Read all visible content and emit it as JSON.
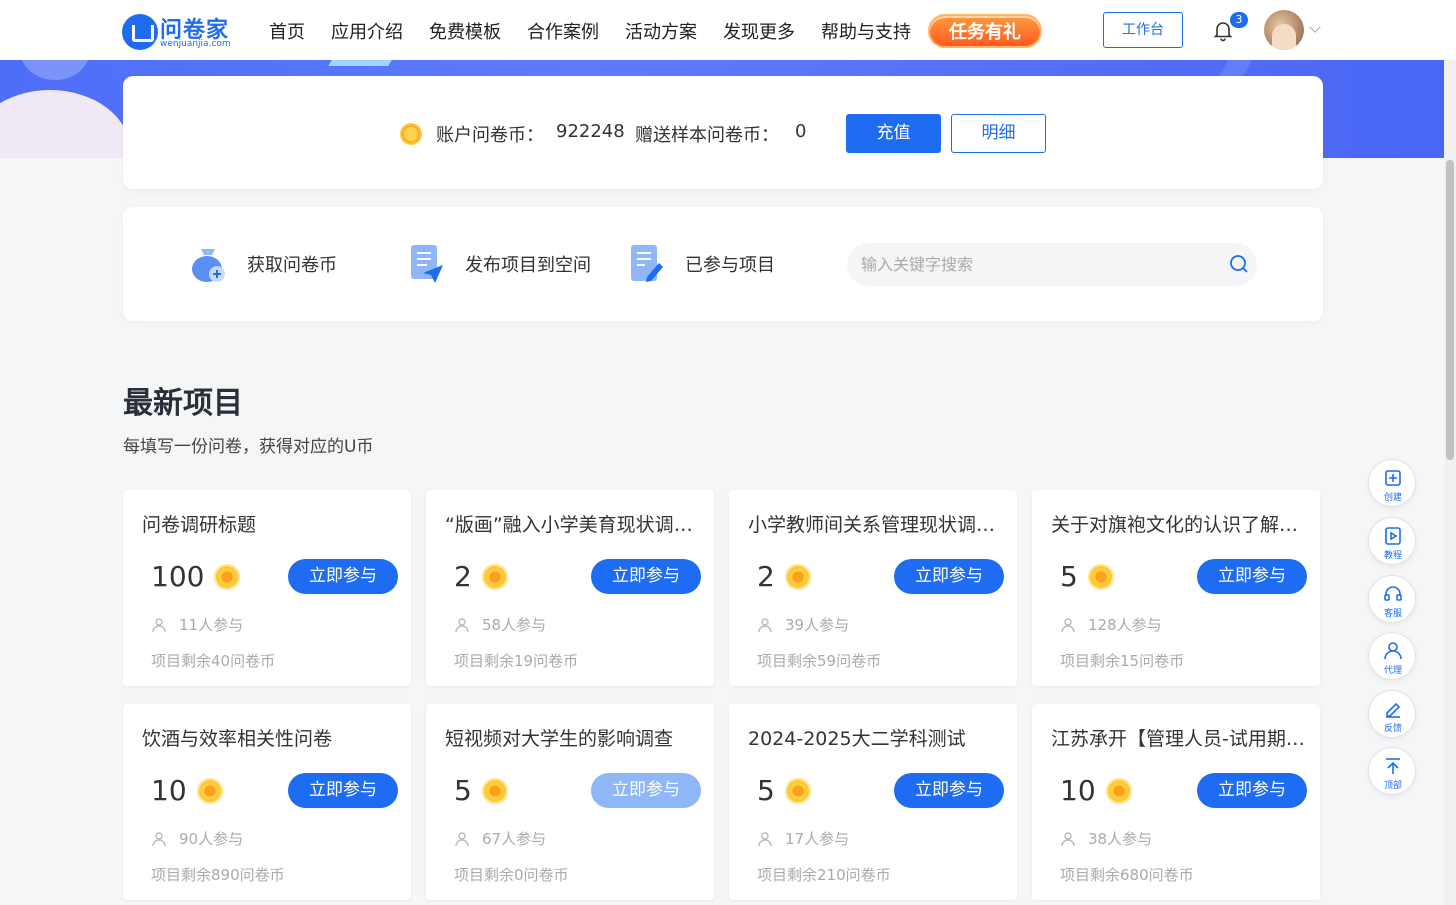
{
  "brand": {
    "name": "问卷家",
    "domain": "wenjuanjia.com"
  },
  "nav": {
    "items": [
      "首页",
      "应用介绍",
      "免费模板",
      "合作案例",
      "活动方案",
      "发现更多",
      "帮助与支持"
    ],
    "promo": "任务有礼",
    "workbench": "工作台",
    "notification_count": "3"
  },
  "coins": {
    "account_label": "账户问卷币：",
    "account_value": "922248",
    "gift_label": "赠送样本问卷币：",
    "gift_value": "0",
    "recharge": "充值",
    "detail": "明细"
  },
  "actions": {
    "get_coins": "获取问卷币",
    "publish": "发布项目到空间",
    "joined": "已参与项目",
    "search_placeholder": "输入关键字搜索"
  },
  "section": {
    "title": "最新项目",
    "subtitle": "每填写一份问卷，获得对应的U币"
  },
  "projects": [
    {
      "title": "问卷调研标题",
      "coins": "100",
      "join": "立即参与",
      "participants": "11人参与",
      "remain": "项目剩余40问卷币",
      "disabled": false
    },
    {
      "title": "“版画”融入小学美育现状调查问卷",
      "coins": "2",
      "join": "立即参与",
      "participants": "58人参与",
      "remain": "项目剩余19问卷币",
      "disabled": false
    },
    {
      "title": "小学教师间关系管理现状调查问卷",
      "coins": "2",
      "join": "立即参与",
      "participants": "39人参与",
      "remain": "项目剩余59问卷币",
      "disabled": false
    },
    {
      "title": "关于对旗袍文化的认识了解调查",
      "coins": "5",
      "join": "立即参与",
      "participants": "128人参与",
      "remain": "项目剩余15问卷币",
      "disabled": false
    },
    {
      "title": "饮酒与效率相关性问卷",
      "coins": "10",
      "join": "立即参与",
      "participants": "90人参与",
      "remain": "项目剩余890问卷币",
      "disabled": false
    },
    {
      "title": "短视频对大学生的影响调查",
      "coins": "5",
      "join": "立即参与",
      "participants": "67人参与",
      "remain": "项目剩余0问卷币",
      "disabled": true
    },
    {
      "title": "2024-2025大二学科测试",
      "coins": "5",
      "join": "立即参与",
      "participants": "17人参与",
      "remain": "项目剩余210问卷币",
      "disabled": false
    },
    {
      "title": "江苏承开【管理人员-试用期】考核",
      "coins": "10",
      "join": "立即参与",
      "participants": "38人参与",
      "remain": "项目剩余680问卷币",
      "disabled": false
    }
  ],
  "float_bar": [
    "创建",
    "教程",
    "客服",
    "代理",
    "反馈",
    "顶部"
  ],
  "colors": {
    "primary": "#1e6cf2",
    "promo": "#ff6a26",
    "coin": "#ffbf20"
  }
}
